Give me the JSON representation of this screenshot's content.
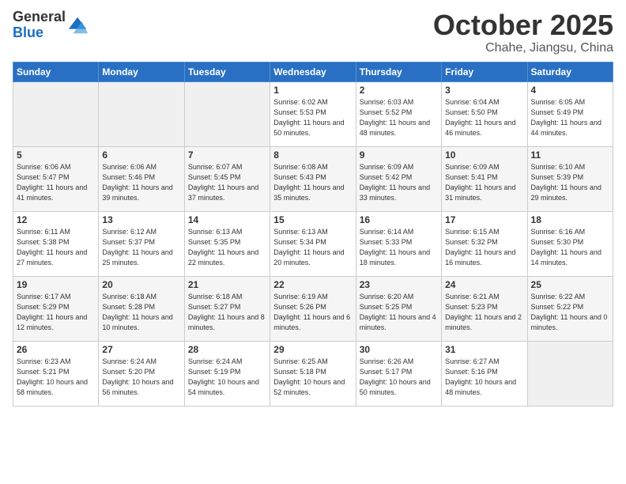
{
  "header": {
    "logo_general": "General",
    "logo_blue": "Blue",
    "month": "October 2025",
    "location": "Chahe, Jiangsu, China"
  },
  "days_of_week": [
    "Sunday",
    "Monday",
    "Tuesday",
    "Wednesday",
    "Thursday",
    "Friday",
    "Saturday"
  ],
  "weeks": [
    [
      {
        "day": "",
        "info": ""
      },
      {
        "day": "",
        "info": ""
      },
      {
        "day": "",
        "info": ""
      },
      {
        "day": "1",
        "info": "Sunrise: 6:02 AM\nSunset: 5:53 PM\nDaylight: 11 hours and 50 minutes."
      },
      {
        "day": "2",
        "info": "Sunrise: 6:03 AM\nSunset: 5:52 PM\nDaylight: 11 hours and 48 minutes."
      },
      {
        "day": "3",
        "info": "Sunrise: 6:04 AM\nSunset: 5:50 PM\nDaylight: 11 hours and 46 minutes."
      },
      {
        "day": "4",
        "info": "Sunrise: 6:05 AM\nSunset: 5:49 PM\nDaylight: 11 hours and 44 minutes."
      }
    ],
    [
      {
        "day": "5",
        "info": "Sunrise: 6:06 AM\nSunset: 5:47 PM\nDaylight: 11 hours and 41 minutes."
      },
      {
        "day": "6",
        "info": "Sunrise: 6:06 AM\nSunset: 5:46 PM\nDaylight: 11 hours and 39 minutes."
      },
      {
        "day": "7",
        "info": "Sunrise: 6:07 AM\nSunset: 5:45 PM\nDaylight: 11 hours and 37 minutes."
      },
      {
        "day": "8",
        "info": "Sunrise: 6:08 AM\nSunset: 5:43 PM\nDaylight: 11 hours and 35 minutes."
      },
      {
        "day": "9",
        "info": "Sunrise: 6:09 AM\nSunset: 5:42 PM\nDaylight: 11 hours and 33 minutes."
      },
      {
        "day": "10",
        "info": "Sunrise: 6:09 AM\nSunset: 5:41 PM\nDaylight: 11 hours and 31 minutes."
      },
      {
        "day": "11",
        "info": "Sunrise: 6:10 AM\nSunset: 5:39 PM\nDaylight: 11 hours and 29 minutes."
      }
    ],
    [
      {
        "day": "12",
        "info": "Sunrise: 6:11 AM\nSunset: 5:38 PM\nDaylight: 11 hours and 27 minutes."
      },
      {
        "day": "13",
        "info": "Sunrise: 6:12 AM\nSunset: 5:37 PM\nDaylight: 11 hours and 25 minutes."
      },
      {
        "day": "14",
        "info": "Sunrise: 6:13 AM\nSunset: 5:35 PM\nDaylight: 11 hours and 22 minutes."
      },
      {
        "day": "15",
        "info": "Sunrise: 6:13 AM\nSunset: 5:34 PM\nDaylight: 11 hours and 20 minutes."
      },
      {
        "day": "16",
        "info": "Sunrise: 6:14 AM\nSunset: 5:33 PM\nDaylight: 11 hours and 18 minutes."
      },
      {
        "day": "17",
        "info": "Sunrise: 6:15 AM\nSunset: 5:32 PM\nDaylight: 11 hours and 16 minutes."
      },
      {
        "day": "18",
        "info": "Sunrise: 6:16 AM\nSunset: 5:30 PM\nDaylight: 11 hours and 14 minutes."
      }
    ],
    [
      {
        "day": "19",
        "info": "Sunrise: 6:17 AM\nSunset: 5:29 PM\nDaylight: 11 hours and 12 minutes."
      },
      {
        "day": "20",
        "info": "Sunrise: 6:18 AM\nSunset: 5:28 PM\nDaylight: 11 hours and 10 minutes."
      },
      {
        "day": "21",
        "info": "Sunrise: 6:18 AM\nSunset: 5:27 PM\nDaylight: 11 hours and 8 minutes."
      },
      {
        "day": "22",
        "info": "Sunrise: 6:19 AM\nSunset: 5:26 PM\nDaylight: 11 hours and 6 minutes."
      },
      {
        "day": "23",
        "info": "Sunrise: 6:20 AM\nSunset: 5:25 PM\nDaylight: 11 hours and 4 minutes."
      },
      {
        "day": "24",
        "info": "Sunrise: 6:21 AM\nSunset: 5:23 PM\nDaylight: 11 hours and 2 minutes."
      },
      {
        "day": "25",
        "info": "Sunrise: 6:22 AM\nSunset: 5:22 PM\nDaylight: 11 hours and 0 minutes."
      }
    ],
    [
      {
        "day": "26",
        "info": "Sunrise: 6:23 AM\nSunset: 5:21 PM\nDaylight: 10 hours and 58 minutes."
      },
      {
        "day": "27",
        "info": "Sunrise: 6:24 AM\nSunset: 5:20 PM\nDaylight: 10 hours and 56 minutes."
      },
      {
        "day": "28",
        "info": "Sunrise: 6:24 AM\nSunset: 5:19 PM\nDaylight: 10 hours and 54 minutes."
      },
      {
        "day": "29",
        "info": "Sunrise: 6:25 AM\nSunset: 5:18 PM\nDaylight: 10 hours and 52 minutes."
      },
      {
        "day": "30",
        "info": "Sunrise: 6:26 AM\nSunset: 5:17 PM\nDaylight: 10 hours and 50 minutes."
      },
      {
        "day": "31",
        "info": "Sunrise: 6:27 AM\nSunset: 5:16 PM\nDaylight: 10 hours and 48 minutes."
      },
      {
        "day": "",
        "info": ""
      }
    ]
  ]
}
